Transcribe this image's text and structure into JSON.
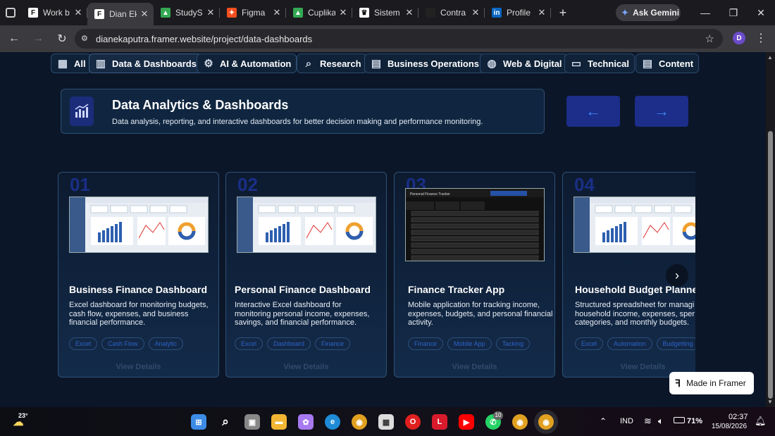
{
  "browser": {
    "tabs": [
      {
        "label": "Work b",
        "icon": "framer-icon",
        "color": "#ffffff"
      },
      {
        "label": "Dian Ek",
        "icon": "framer-icon",
        "color": "#ffffff",
        "active": true
      },
      {
        "label": "StudySp",
        "icon": "google-drive-icon",
        "color": "#34a853"
      },
      {
        "label": "Figma",
        "icon": "figma-icon",
        "color": "#f24e1e"
      },
      {
        "label": "Cuplika",
        "icon": "google-drive-icon",
        "color": "#34a853"
      },
      {
        "label": "Sistem",
        "icon": "crown-icon",
        "color": "#ffffff"
      },
      {
        "label": "Contra",
        "icon": "contra-icon",
        "color": "#222222"
      },
      {
        "label": "Profile",
        "icon": "linkedin-icon",
        "color": "#0a66c2"
      }
    ],
    "new_tab": "+",
    "gemini_label": "Ask Gemini",
    "url": "dianekaputra.framer.website/project/data-dashboards",
    "profile_initial": "D"
  },
  "filters": [
    {
      "label": "All",
      "icon": "grid-icon"
    },
    {
      "label": "Data & Dashboards",
      "icon": "bar-chart-icon",
      "selected": true
    },
    {
      "label": "AI & Automation",
      "icon": "gear-icon"
    },
    {
      "label": "Research",
      "icon": "search-icon"
    },
    {
      "label": "Business Operations",
      "icon": "briefcase-icon"
    },
    {
      "label": "Web & Digital",
      "icon": "globe-icon"
    },
    {
      "label": "Technical",
      "icon": "monitor-icon"
    },
    {
      "label": "Content",
      "icon": "document-icon"
    }
  ],
  "hero": {
    "title": "Data Analytics & Dashboards",
    "subtitle": "Data analysis, reporting, and interactive dashboards for better decision making and performance monitoring."
  },
  "cards": [
    {
      "num": "01",
      "title": "Business Finance Dashboard",
      "desc": "Excel dashboard for monitoring budgets, cash flow, expenses, and business financial performance.",
      "tags": [
        "Excel",
        "Cash Flow",
        "Analytic"
      ],
      "view": "View Details"
    },
    {
      "num": "02",
      "title": "Personal Finance Dashboard",
      "desc": "Interactive Excel dashboard for monitoring personal income, expenses, savings, and financial performance.",
      "tags": [
        "Excel",
        "Dashboard",
        "Finance"
      ],
      "view": "View Details"
    },
    {
      "num": "03",
      "title": "Finance Tracker App",
      "desc": "Mobile application for tracking income, expenses, budgets, and personal financial activity.",
      "tags": [
        "Finance",
        "Mobile App",
        "Tacking"
      ],
      "view": "View Details"
    },
    {
      "num": "04",
      "title": "Household Budget Planne",
      "desc": "Structured spreadsheet for managi household income, expenses, sper categories, and monthly budgets.",
      "tags": [
        "Excel",
        "Automation",
        "Budgetting"
      ],
      "view": "View Details"
    }
  ],
  "made_in_framer": "Made in Framer",
  "taskbar": {
    "weather_temp": "23°",
    "lang": "IND",
    "battery": "71%",
    "time": "02:37",
    "date": "15/08/2026",
    "whatsapp_badge": "10"
  }
}
